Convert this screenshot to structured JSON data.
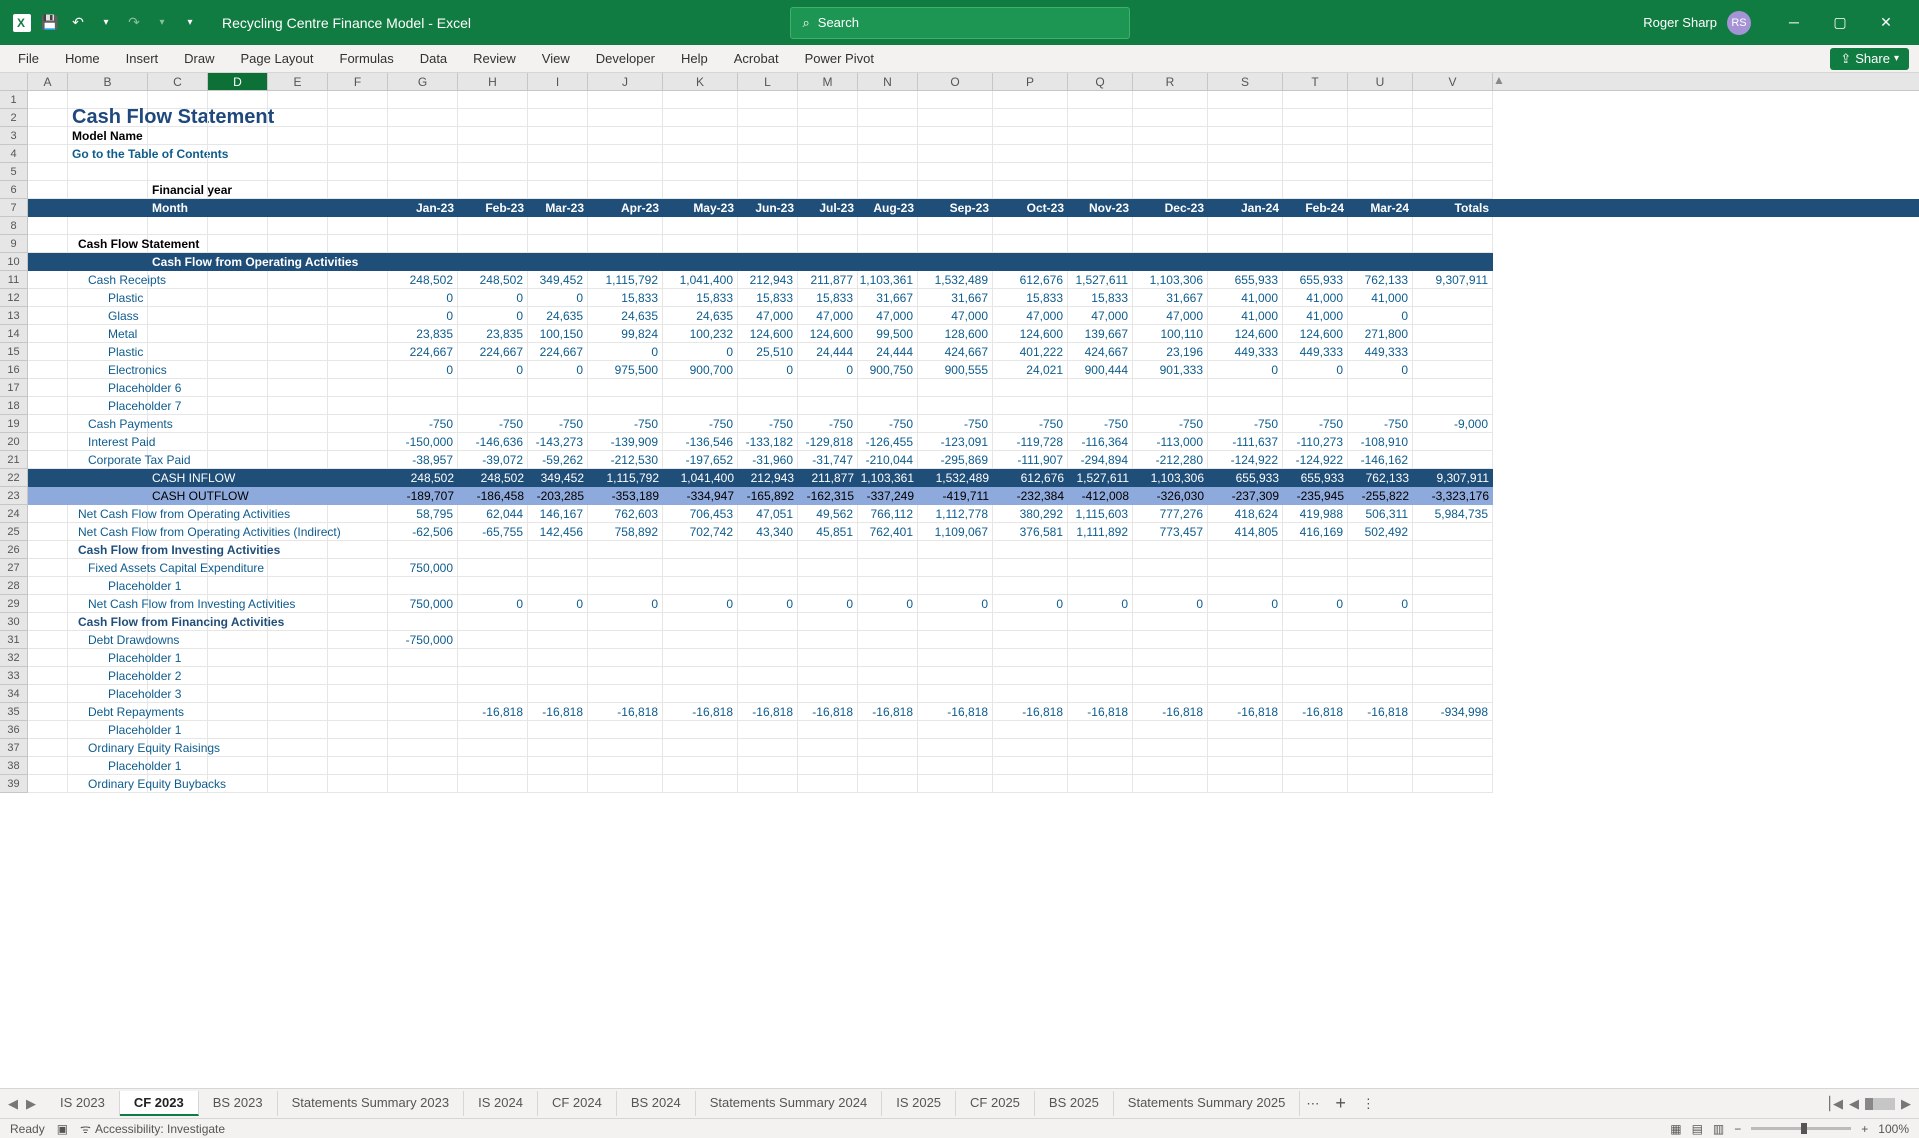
{
  "app": {
    "title": "Recycling Centre Finance Model  -  Excel",
    "user": "Roger Sharp",
    "initials": "RS",
    "search_placeholder": "Search"
  },
  "ribbon": [
    "File",
    "Home",
    "Insert",
    "Draw",
    "Page Layout",
    "Formulas",
    "Data",
    "Review",
    "View",
    "Developer",
    "Help",
    "Acrobat",
    "Power Pivot"
  ],
  "share": "Share",
  "cols": [
    "A",
    "B",
    "C",
    "D",
    "E",
    "F",
    "G",
    "H",
    "I",
    "J",
    "K",
    "L",
    "M",
    "N",
    "O",
    "P",
    "Q",
    "R",
    "S",
    "T",
    "U",
    "V"
  ],
  "sheet": {
    "title": "Cash Flow Statement",
    "model": "Model Name",
    "toc": "Go to the Table of Contents",
    "fy": "Financial year",
    "month_label": "Month",
    "months": [
      "Jan-23",
      "Feb-23",
      "Mar-23",
      "Apr-23",
      "May-23",
      "Jun-23",
      "Jul-23",
      "Aug-23",
      "Sep-23",
      "Oct-23",
      "Nov-23",
      "Dec-23",
      "Jan-24",
      "Feb-24",
      "Mar-24",
      "Totals"
    ],
    "sections": {
      "cfs": "Cash Flow Statement",
      "cfo": "Cash Flow from Operating Activities",
      "cfi": "Cash Flow from Investing Activities",
      "cff": "Cash Flow from Financing Activities"
    },
    "rows": {
      "cash_receipts": {
        "label": "Cash Receipts",
        "vals": [
          "248,502",
          "248,502",
          "349,452",
          "1,115,792",
          "1,041,400",
          "212,943",
          "211,877",
          "1,103,361",
          "1,532,489",
          "612,676",
          "1,527,611",
          "1,103,306",
          "655,933",
          "655,933",
          "762,133",
          "9,307,911"
        ]
      },
      "plastic1": {
        "label": "Plastic",
        "vals": [
          "0",
          "0",
          "0",
          "15,833",
          "15,833",
          "15,833",
          "15,833",
          "31,667",
          "31,667",
          "15,833",
          "15,833",
          "31,667",
          "41,000",
          "41,000",
          "41,000",
          ""
        ]
      },
      "glass": {
        "label": "Glass",
        "vals": [
          "0",
          "0",
          "24,635",
          "24,635",
          "24,635",
          "47,000",
          "47,000",
          "47,000",
          "47,000",
          "47,000",
          "47,000",
          "47,000",
          "41,000",
          "41,000",
          "0",
          ""
        ]
      },
      "metal": {
        "label": "Metal",
        "vals": [
          "23,835",
          "23,835",
          "100,150",
          "99,824",
          "100,232",
          "124,600",
          "124,600",
          "99,500",
          "128,600",
          "124,600",
          "139,667",
          "100,110",
          "124,600",
          "124,600",
          "271,800",
          ""
        ]
      },
      "plastic2": {
        "label": "Plastic",
        "vals": [
          "224,667",
          "224,667",
          "224,667",
          "0",
          "0",
          "25,510",
          "24,444",
          "24,444",
          "424,667",
          "401,222",
          "424,667",
          "23,196",
          "449,333",
          "449,333",
          "449,333",
          ""
        ]
      },
      "electronics": {
        "label": "Electronics",
        "vals": [
          "0",
          "0",
          "0",
          "975,500",
          "900,700",
          "0",
          "0",
          "900,750",
          "900,555",
          "24,021",
          "900,444",
          "901,333",
          "0",
          "0",
          "0",
          ""
        ]
      },
      "ph6": {
        "label": "Placeholder 6"
      },
      "ph7": {
        "label": "Placeholder 7"
      },
      "cash_payments": {
        "label": "Cash Payments",
        "vals": [
          "-750",
          "-750",
          "-750",
          "-750",
          "-750",
          "-750",
          "-750",
          "-750",
          "-750",
          "-750",
          "-750",
          "-750",
          "-750",
          "-750",
          "-750",
          "-9,000"
        ]
      },
      "interest": {
        "label": "Interest Paid",
        "vals": [
          "-150,000",
          "-146,636",
          "-143,273",
          "-139,909",
          "-136,546",
          "-133,182",
          "-129,818",
          "-126,455",
          "-123,091",
          "-119,728",
          "-116,364",
          "-113,000",
          "-111,637",
          "-110,273",
          "-108,910",
          ""
        ]
      },
      "tax": {
        "label": "Corporate Tax Paid",
        "vals": [
          "-38,957",
          "-39,072",
          "-59,262",
          "-212,530",
          "-197,652",
          "-31,960",
          "-31,747",
          "-210,044",
          "-295,869",
          "-111,907",
          "-294,894",
          "-212,280",
          "-124,922",
          "-124,922",
          "-146,162",
          ""
        ]
      },
      "inflow": {
        "label": "CASH INFLOW",
        "vals": [
          "248,502",
          "248,502",
          "349,452",
          "1,115,792",
          "1,041,400",
          "212,943",
          "211,877",
          "1,103,361",
          "1,532,489",
          "612,676",
          "1,527,611",
          "1,103,306",
          "655,933",
          "655,933",
          "762,133",
          "9,307,911"
        ]
      },
      "outflow": {
        "label": "CASH OUTFLOW",
        "vals": [
          "-189,707",
          "-186,458",
          "-203,285",
          "-353,189",
          "-334,947",
          "-165,892",
          "-162,315",
          "-337,249",
          "-419,711",
          "-232,384",
          "-412,008",
          "-326,030",
          "-237,309",
          "-235,945",
          "-255,822",
          "-3,323,176"
        ]
      },
      "netop": {
        "label": "Net Cash Flow from Operating Activities",
        "vals": [
          "58,795",
          "62,044",
          "146,167",
          "762,603",
          "706,453",
          "47,051",
          "49,562",
          "766,112",
          "1,112,778",
          "380,292",
          "1,115,603",
          "777,276",
          "418,624",
          "419,988",
          "506,311",
          "5,984,735"
        ]
      },
      "netop_ind": {
        "label": "Net Cash Flow from Operating Activities (Indirect)",
        "vals": [
          "-62,506",
          "-65,755",
          "142,456",
          "758,892",
          "702,742",
          "43,340",
          "45,851",
          "762,401",
          "1,109,067",
          "376,581",
          "1,111,892",
          "773,457",
          "414,805",
          "416,169",
          "502,492",
          ""
        ]
      },
      "fixassets": {
        "label": "Fixed Assets Capital Expenditure",
        "vals": [
          "750,000",
          "",
          "",
          "",
          "",
          "",
          "",
          "",
          "",
          "",
          "",
          "",
          "",
          "",
          "",
          ""
        ]
      },
      "ph1a": {
        "label": "Placeholder 1"
      },
      "netinv": {
        "label": "Net Cash Flow from Investing Activities",
        "vals": [
          "750,000",
          "0",
          "0",
          "0",
          "0",
          "0",
          "0",
          "0",
          "0",
          "0",
          "0",
          "0",
          "0",
          "0",
          "0",
          ""
        ]
      },
      "debtdraw": {
        "label": "Debt Drawdowns",
        "vals": [
          "-750,000",
          "",
          "",
          "",
          "",
          "",
          "",
          "",
          "",
          "",
          "",
          "",
          "",
          "",
          "",
          ""
        ]
      },
      "ph1b": {
        "label": "Placeholder 1"
      },
      "ph2": {
        "label": "Placeholder 2"
      },
      "ph3": {
        "label": "Placeholder 3"
      },
      "debtrepay": {
        "label": "Debt Repayments",
        "vals": [
          "",
          "-16,818",
          "-16,818",
          "-16,818",
          "-16,818",
          "-16,818",
          "-16,818",
          "-16,818",
          "-16,818",
          "-16,818",
          "-16,818",
          "-16,818",
          "-16,818",
          "-16,818",
          "-16,818",
          "-934,998"
        ]
      },
      "ph1c": {
        "label": "Placeholder 1"
      },
      "equity_rais": {
        "label": "Ordinary Equity Raisings"
      },
      "ph1d": {
        "label": "Placeholder 1"
      },
      "equity_buy": {
        "label": "Ordinary Equity Buybacks"
      }
    }
  },
  "tabs": [
    "IS 2023",
    "CF 2023",
    "BS 2023",
    "Statements Summary 2023",
    "IS 2024",
    "CF 2024",
    "BS 2024",
    "Statements Summary 2024",
    "IS 2025",
    "CF 2025",
    "BS 2025",
    "Statements Summary 2025"
  ],
  "status": {
    "ready": "Ready",
    "access": "Accessibility: Investigate",
    "zoom": "100%"
  }
}
